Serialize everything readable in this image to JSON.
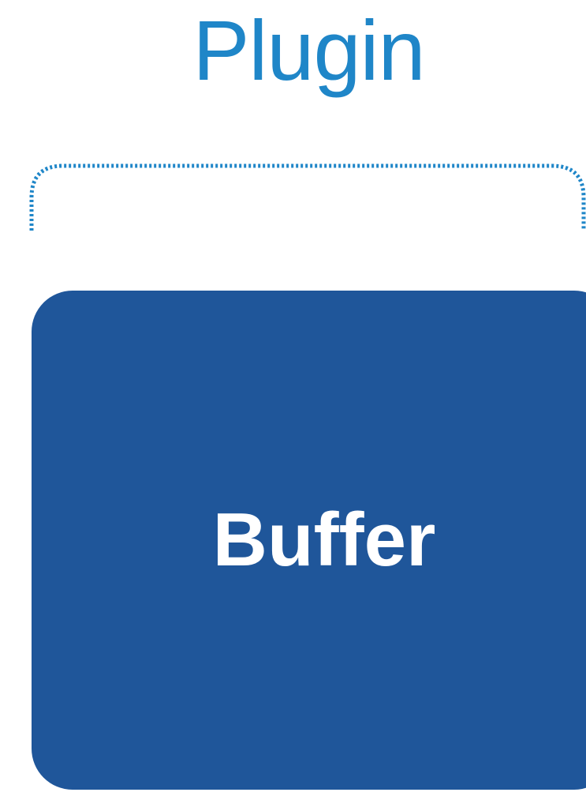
{
  "diagram": {
    "container_label": "Plugin",
    "node_label": "Buffer",
    "colors": {
      "title": "#1f86c8",
      "bracket": "#1f86c8",
      "node_fill": "#1f569a",
      "node_text": "#ffffff"
    }
  }
}
